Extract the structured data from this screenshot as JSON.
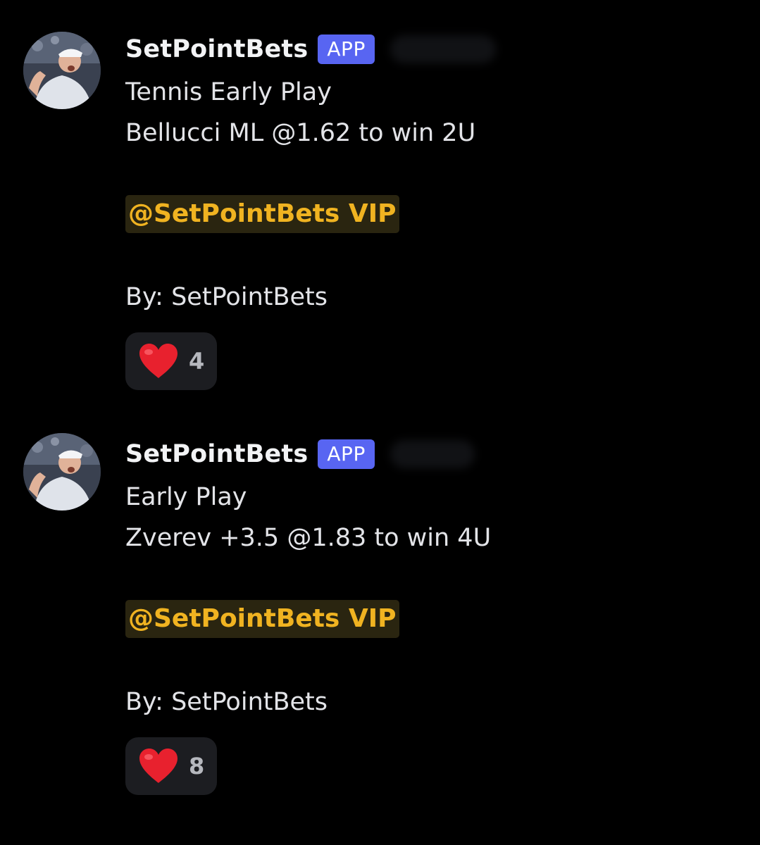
{
  "messages": [
    {
      "username": "SetPointBets",
      "badge": "APP",
      "lines": [
        "Tennis Early Play",
        "Bellucci ML @1.62 to win 2U"
      ],
      "mention": "@SetPointBets VIP",
      "byline": "By: SetPointBets",
      "reaction": {
        "icon": "heart-icon",
        "count": "4"
      }
    },
    {
      "username": "SetPointBets",
      "badge": "APP",
      "lines": [
        "Early Play",
        "Zverev +3.5 @1.83 to win 4U"
      ],
      "mention": "@SetPointBets VIP",
      "byline": "By: SetPointBets",
      "reaction": {
        "icon": "heart-icon",
        "count": "8"
      }
    }
  ],
  "colors": {
    "background": "#000000",
    "badge": "#5865f2",
    "mention_text": "#f0b321",
    "mention_bg": "#2a2510",
    "reaction_bg": "#1c1d21"
  }
}
